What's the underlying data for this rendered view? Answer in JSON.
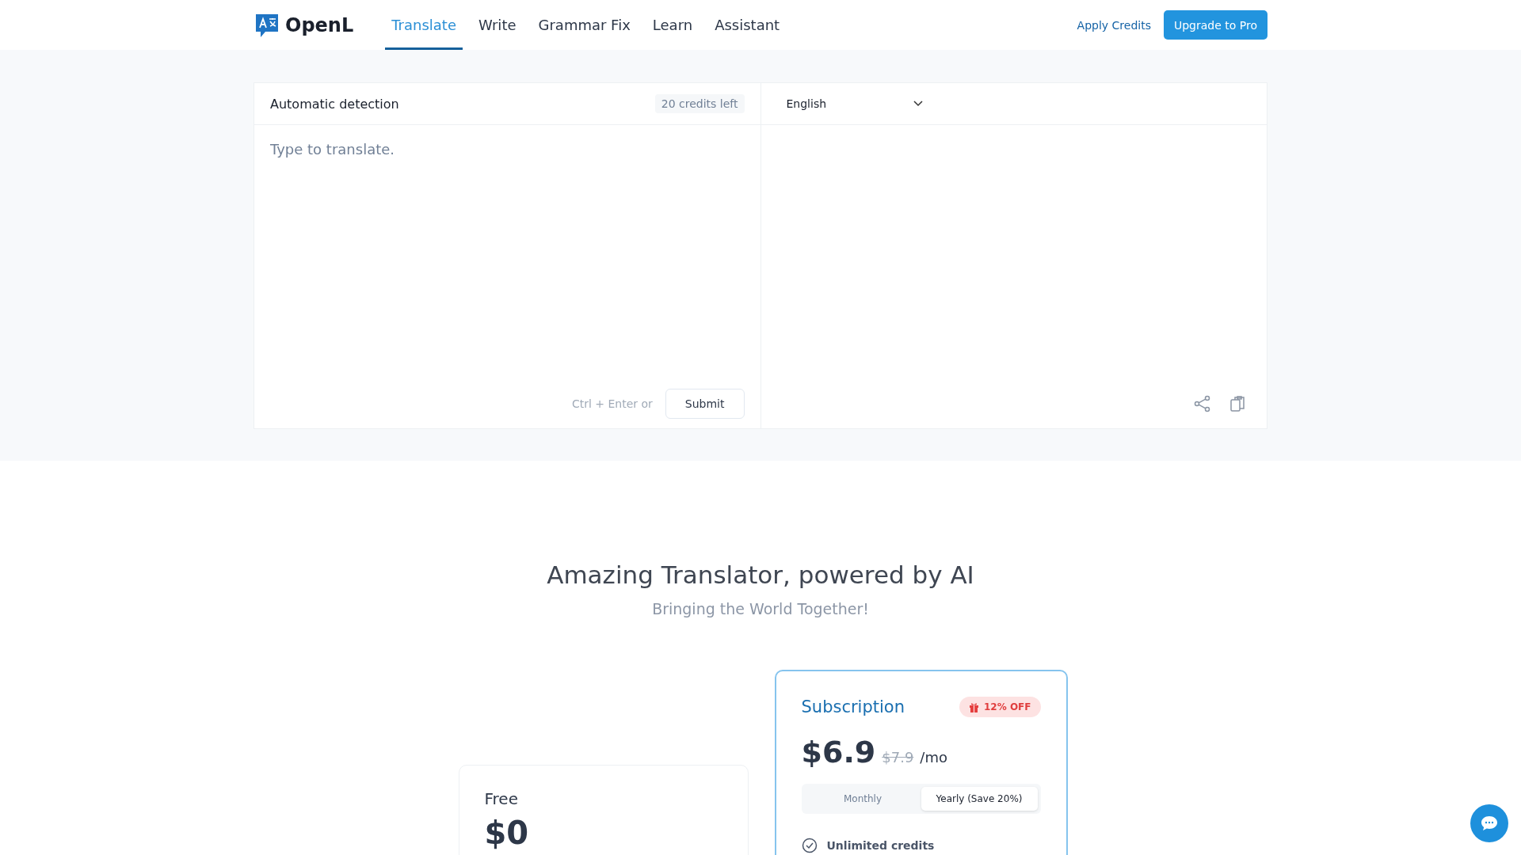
{
  "header": {
    "logo": "OpenL",
    "nav": [
      {
        "label": "Translate",
        "selected": true
      },
      {
        "label": "Write",
        "selected": false
      },
      {
        "label": "Grammar Fix",
        "selected": false
      },
      {
        "label": "Learn",
        "selected": false
      },
      {
        "label": "Assistant",
        "selected": false
      }
    ],
    "apply_credits": "Apply Credits",
    "upgrade": "Upgrade to Pro"
  },
  "translator": {
    "source_language": "Automatic detection",
    "credits": "20 credits left",
    "target_language": "English",
    "placeholder": "Type to translate.",
    "shortcut_hint": "Ctrl + Enter or",
    "submit": "Submit"
  },
  "hero": {
    "title": "Amazing Translator, powered by AI",
    "subtitle": "Bringing the World Together!"
  },
  "pricing": {
    "free": {
      "name": "Free",
      "price": "$0"
    },
    "subscription": {
      "name": "Subscription",
      "discount": "12% OFF",
      "price": "$6.9",
      "old_price": "$7.9",
      "period": "/mo",
      "billing": [
        {
          "label": "Monthly",
          "selected": false
        },
        {
          "label": "Yearly (Save 20%)",
          "selected": true
        }
      ],
      "features": [
        "Unlimited credits"
      ]
    }
  }
}
